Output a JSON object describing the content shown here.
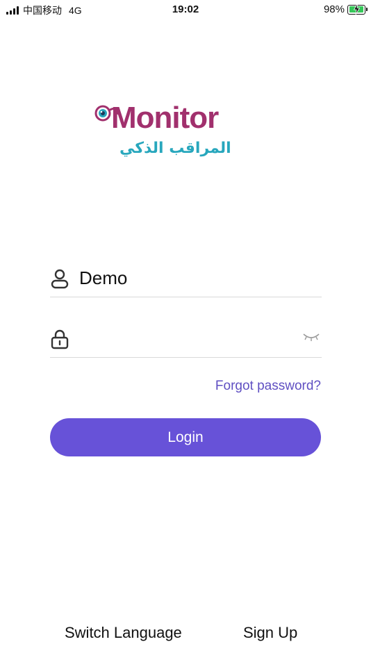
{
  "status_bar": {
    "carrier": "中国移动",
    "network": "4G",
    "time": "19:02",
    "battery": "98%",
    "battery_level": 0.98
  },
  "logo": {
    "wordmark": "Monitor",
    "arabic_tagline": "المراقب الذكي"
  },
  "form": {
    "username": {
      "value": "Demo",
      "icon": "user-icon"
    },
    "password": {
      "value": "",
      "icon": "lock-icon",
      "toggle_icon": "eye-closed-icon"
    },
    "forgot_password": "Forgot password?",
    "login_button": "Login"
  },
  "footer": {
    "switch_language": "Switch Language",
    "sign_up": "Sign Up"
  },
  "colors": {
    "accent": "#6752d8",
    "link": "#5f4fc2",
    "logo_magenta": "#a1306d",
    "logo_teal": "#28a7bd",
    "battery_green": "#35c759"
  }
}
